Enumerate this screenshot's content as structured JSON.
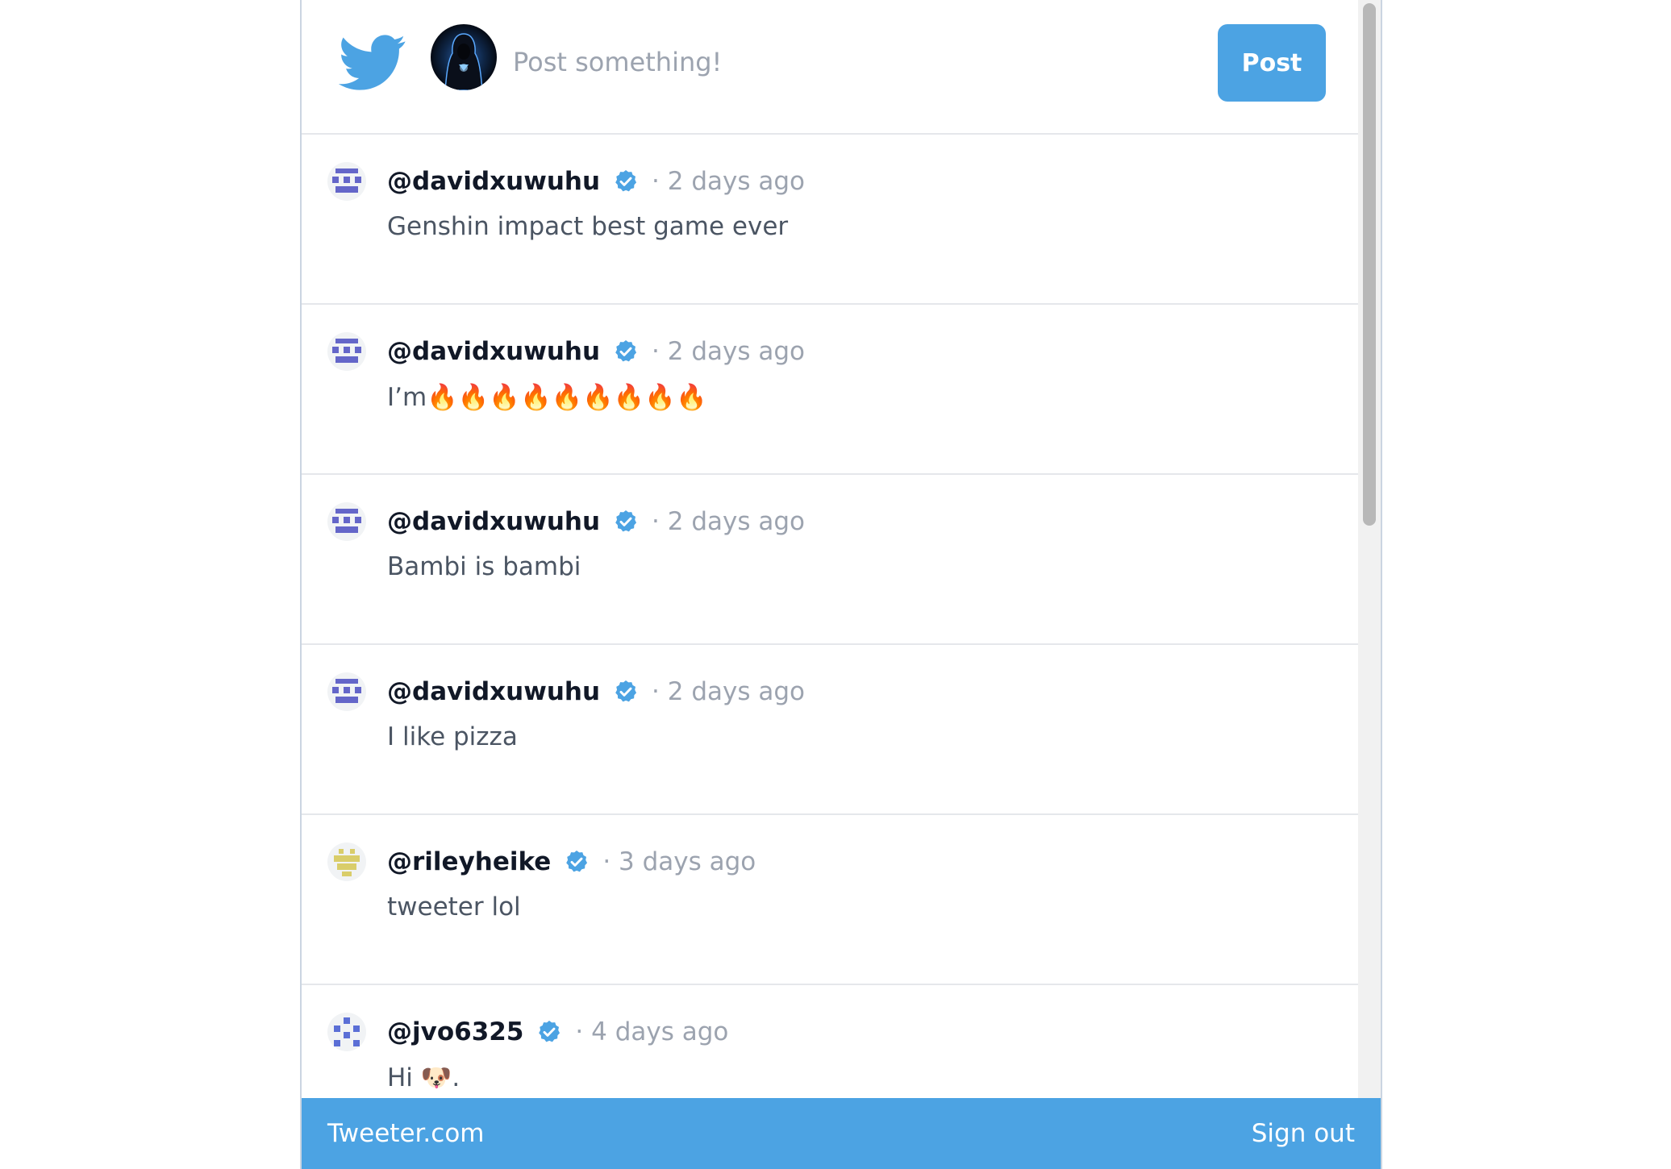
{
  "composer": {
    "placeholder": "Post something!",
    "post_button_label": "Post"
  },
  "tweets": [
    {
      "username": "@davidxuwuhu",
      "time": "· 2 days ago",
      "text": "Genshin impact best game ever",
      "avatar": "purple-pixel-avatar"
    },
    {
      "username": "@davidxuwuhu",
      "time": "· 2 days ago",
      "text": "I’m🔥🔥🔥🔥🔥🔥🔥🔥🔥",
      "avatar": "purple-pixel-avatar"
    },
    {
      "username": "@davidxuwuhu",
      "time": "· 2 days ago",
      "text": "Bambi is bambi",
      "avatar": "purple-pixel-avatar"
    },
    {
      "username": "@davidxuwuhu",
      "time": "· 2 days ago",
      "text": "I like pizza",
      "avatar": "purple-pixel-avatar"
    },
    {
      "username": "@rileyheike",
      "time": "· 3 days ago",
      "text": "tweeter lol",
      "avatar": "yellow-pixel-avatar"
    },
    {
      "username": "@jvo6325",
      "time": "· 4 days ago",
      "text": "Hi 🐶.",
      "avatar": "blue-pixel-avatar"
    }
  ],
  "footer": {
    "brand": "Tweeter.com",
    "sign_out": "Sign out"
  },
  "icons": {
    "logo": "twitter-bird-icon",
    "verified": "verified-badge-icon"
  },
  "colors": {
    "accent": "#4ca3e3",
    "purple_avatar": "#6466c9",
    "yellow_avatar": "#d9cd6a",
    "blue_avatar": "#5b6fd6"
  }
}
